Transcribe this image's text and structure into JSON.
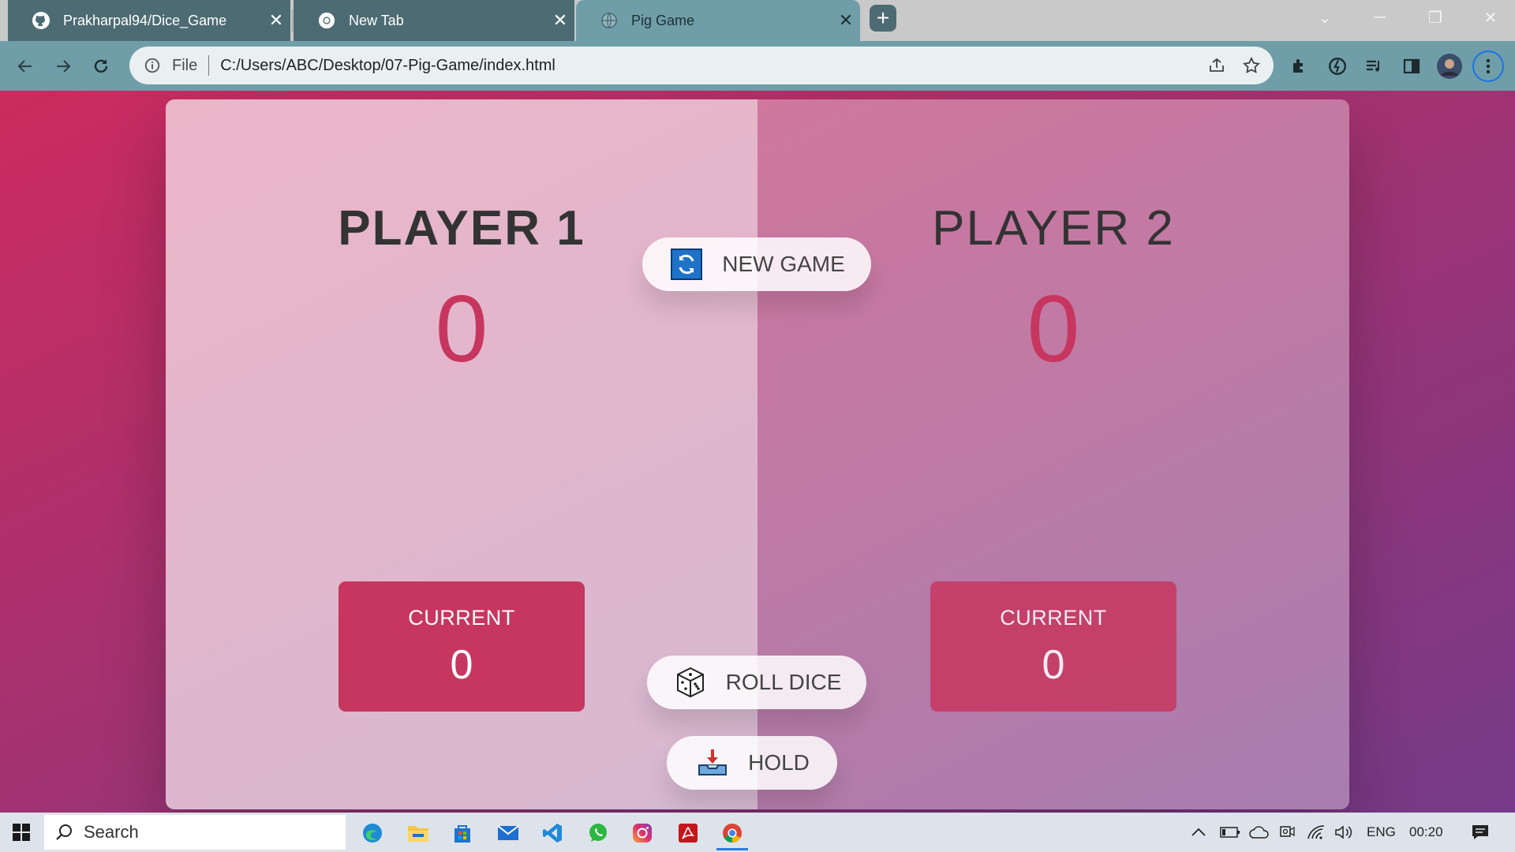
{
  "browser": {
    "tabs": [
      {
        "title": "Prakharpal94/Dice_Game",
        "icon": "github-icon",
        "active": false
      },
      {
        "title": "New Tab",
        "icon": "chrome-icon",
        "active": false
      },
      {
        "title": "Pig Game",
        "icon": "globe-icon",
        "active": true
      }
    ],
    "address": {
      "scheme_label": "File",
      "url": "C:/Users/ABC/Desktop/07-Pig-Game/index.html"
    }
  },
  "game": {
    "players": [
      {
        "name": "PLAYER 1",
        "score": "0",
        "current_label": "CURRENT",
        "current_score": "0",
        "active": true
      },
      {
        "name": "PLAYER 2",
        "score": "0",
        "current_label": "CURRENT",
        "current_score": "0",
        "active": false
      }
    ],
    "buttons": {
      "new_game": {
        "label": "NEW GAME",
        "icon": "refresh-icon"
      },
      "roll_dice": {
        "label": "ROLL DICE",
        "icon": "dice-icon"
      },
      "hold": {
        "label": "HOLD",
        "icon": "inbox-download-icon"
      }
    },
    "colors": {
      "accent": "#c7365f",
      "bg_from": "#cc2b5e",
      "bg_to": "#753a88"
    }
  },
  "taskbar": {
    "search_placeholder": "Search",
    "apps": [
      "edge-icon",
      "file-explorer-icon",
      "store-icon",
      "mail-icon",
      "vscode-icon",
      "whatsapp-icon",
      "instagram-icon",
      "acrobat-icon",
      "chrome-icon"
    ],
    "language": "ENG",
    "time": "00:20"
  }
}
